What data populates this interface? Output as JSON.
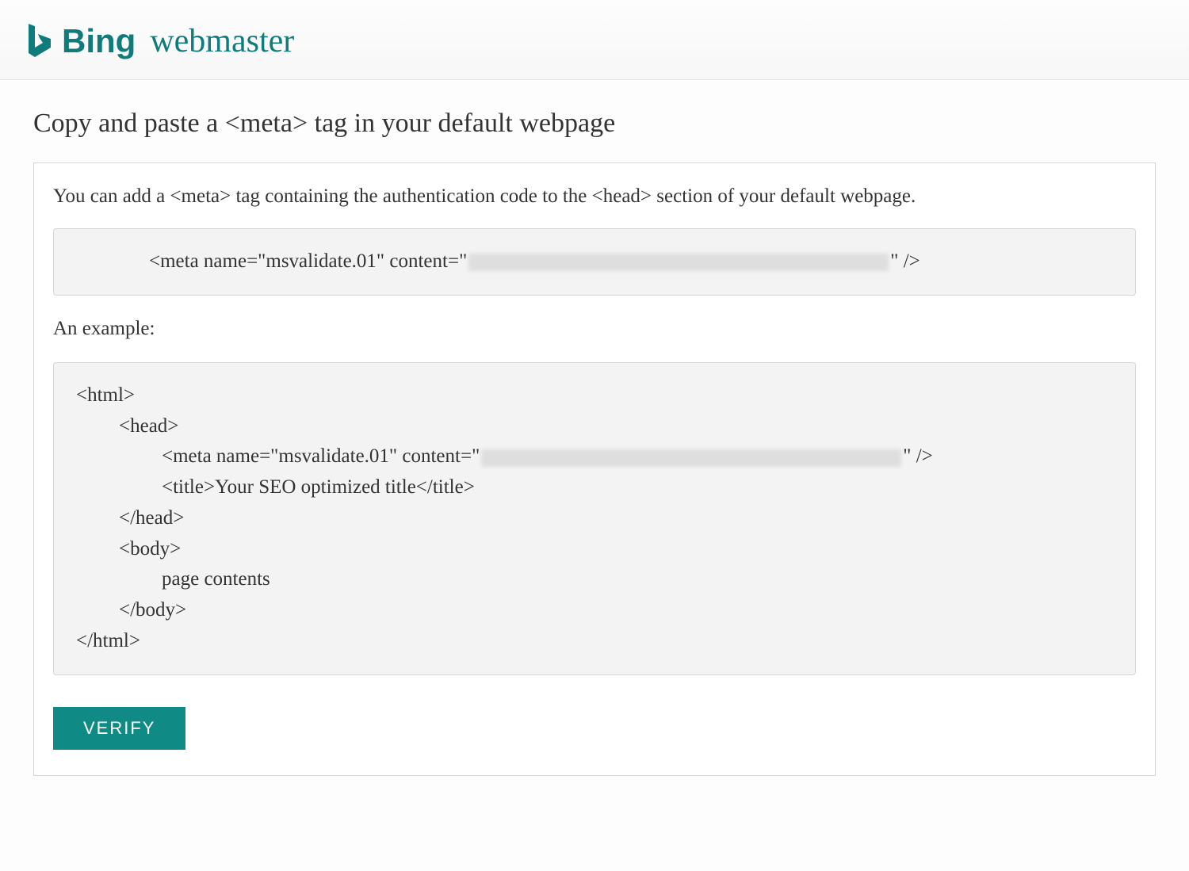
{
  "header": {
    "brand_name": "Bing",
    "product_name": "webmaster"
  },
  "page": {
    "title": "Copy and paste a <meta> tag in your default webpage",
    "instruction": "You can add a <meta> tag containing the authentication code to the <head> section of your default webpage.",
    "meta_prefix": "<meta name=\"msvalidate.01\" content=\"",
    "meta_suffix": "\" />",
    "example_label": "An example:",
    "example": {
      "html_open": "<html>",
      "head_open": "<head>",
      "meta_prefix": "<meta name=\"msvalidate.01\" content=\"",
      "meta_suffix": "\" />",
      "title_line": "<title>Your SEO optimized title</title>",
      "head_close": "</head>",
      "body_open": "<body>",
      "body_content": "page contents",
      "body_close": "</body>",
      "html_close": "</html>"
    },
    "verify_button_label": "VERIFY"
  },
  "colors": {
    "brand": "#0f7b7b",
    "button": "#0f8a84"
  }
}
